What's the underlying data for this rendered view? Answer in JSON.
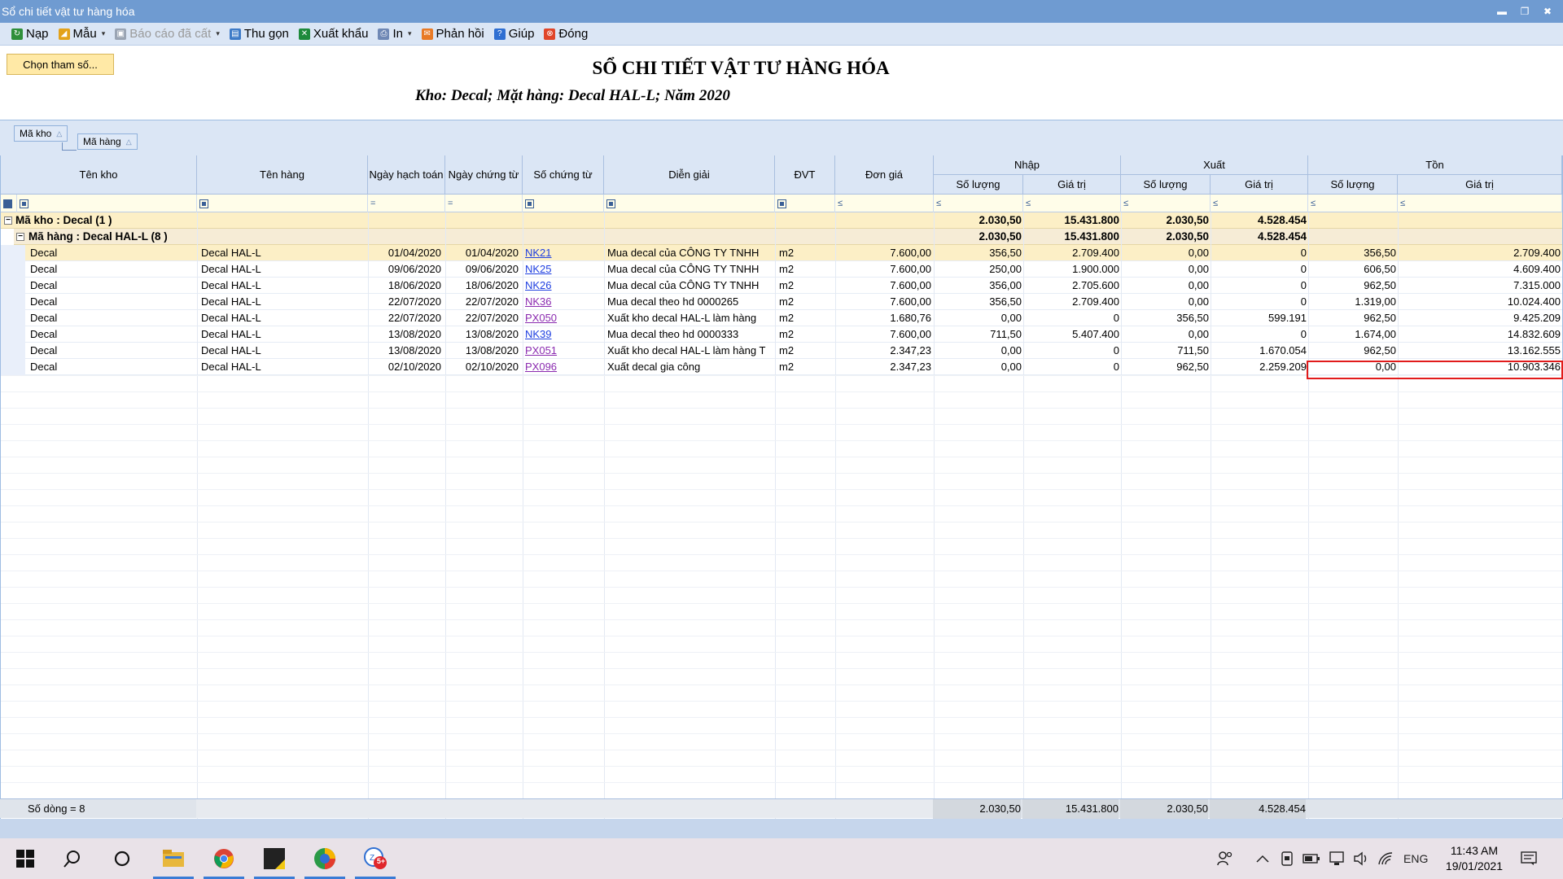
{
  "window": {
    "title": "Sổ chi tiết vật tư hàng hóa"
  },
  "toolbar": {
    "items": [
      {
        "label": "Nạp",
        "icon": "refresh-icon",
        "color": "#2f8f3a",
        "disabled": false,
        "dropdown": false
      },
      {
        "label": "Mẫu",
        "icon": "template-icon",
        "color": "#e3a21a",
        "disabled": false,
        "dropdown": true
      },
      {
        "label": "Báo cáo đã cất",
        "icon": "save-icon",
        "color": "#9aa4b3",
        "disabled": true,
        "dropdown": true
      },
      {
        "label": "Thu gọn",
        "icon": "collapse-icon",
        "color": "#3e7bc7",
        "disabled": false,
        "dropdown": false
      },
      {
        "label": "Xuất khẩu",
        "icon": "excel-icon",
        "color": "#1e8a3c",
        "disabled": false,
        "dropdown": false
      },
      {
        "label": "In",
        "icon": "printer-icon",
        "color": "#6f88b5",
        "disabled": false,
        "dropdown": true
      },
      {
        "label": "Phản hồi",
        "icon": "mail-icon",
        "color": "#e87a26",
        "disabled": false,
        "dropdown": false
      },
      {
        "label": "Giúp",
        "icon": "help-icon",
        "color": "#2f6fd2",
        "disabled": false,
        "dropdown": false
      },
      {
        "label": "Đóng",
        "icon": "close-icon",
        "color": "#e0462a",
        "disabled": false,
        "dropdown": false
      }
    ]
  },
  "params_button": "Chọn tham số...",
  "report": {
    "title": "SỔ CHI TIẾT VẬT TƯ HÀNG HÓA",
    "subtitle": "Kho: Decal; Mặt hàng: Decal HAL-L; Năm 2020"
  },
  "group_panel": {
    "chip1": "Mã kho",
    "chip2": "Mã hàng"
  },
  "columns": {
    "ten_kho": "Tên kho",
    "ten_hang": "Tên hàng",
    "ngay_hach_toan": "Ngày hạch toán",
    "ngay_chung_tu": "Ngày chứng từ",
    "so_chung_tu": "Số chứng từ",
    "dien_giai": "Diễn giải",
    "dvt": "ĐVT",
    "don_gia": "Đơn giá",
    "nhap": "Nhập",
    "xuat": "Xuất",
    "ton": "Tồn",
    "so_luong": "Số lượng",
    "gia_tri": "Giá trị"
  },
  "group1": {
    "label": "Mã kho : Decal (1 )",
    "nhap_sl": "2.030,50",
    "nhap_gt": "15.431.800",
    "xuat_sl": "2.030,50",
    "xuat_gt": "4.528.454"
  },
  "group2": {
    "label": "Mã hàng : Decal HAL-L (8 )",
    "nhap_sl": "2.030,50",
    "nhap_gt": "15.431.800",
    "xuat_sl": "2.030,50",
    "xuat_gt": "4.528.454"
  },
  "rows": [
    {
      "kho": "Decal",
      "hang": "Decal HAL-L",
      "nht": "01/04/2020",
      "nct": "01/04/2020",
      "sct": "NK21",
      "link": "blue",
      "dg": "Mua decal của CÔNG TY TNHH",
      "dvt": "m2",
      "gia": "7.600,00",
      "n_sl": "356,50",
      "n_gt": "2.709.400",
      "x_sl": "0,00",
      "x_gt": "0",
      "t_sl": "356,50",
      "t_gt": "2.709.400"
    },
    {
      "kho": "Decal",
      "hang": "Decal HAL-L",
      "nht": "09/06/2020",
      "nct": "09/06/2020",
      "sct": "NK25",
      "link": "blue",
      "dg": "Mua decal của CÔNG TY TNHH",
      "dvt": "m2",
      "gia": "7.600,00",
      "n_sl": "250,00",
      "n_gt": "1.900.000",
      "x_sl": "0,00",
      "x_gt": "0",
      "t_sl": "606,50",
      "t_gt": "4.609.400"
    },
    {
      "kho": "Decal",
      "hang": "Decal HAL-L",
      "nht": "18/06/2020",
      "nct": "18/06/2020",
      "sct": "NK26",
      "link": "blue",
      "dg": "Mua decal của CÔNG TY TNHH",
      "dvt": "m2",
      "gia": "7.600,00",
      "n_sl": "356,00",
      "n_gt": "2.705.600",
      "x_sl": "0,00",
      "x_gt": "0",
      "t_sl": "962,50",
      "t_gt": "7.315.000"
    },
    {
      "kho": "Decal",
      "hang": "Decal HAL-L",
      "nht": "22/07/2020",
      "nct": "22/07/2020",
      "sct": "NK36",
      "link": "purple",
      "dg": "Mua decal theo hd 0000265",
      "dvt": "m2",
      "gia": "7.600,00",
      "n_sl": "356,50",
      "n_gt": "2.709.400",
      "x_sl": "0,00",
      "x_gt": "0",
      "t_sl": "1.319,00",
      "t_gt": "10.024.400"
    },
    {
      "kho": "Decal",
      "hang": "Decal HAL-L",
      "nht": "22/07/2020",
      "nct": "22/07/2020",
      "sct": "PX050",
      "link": "purple",
      "dg": "Xuất kho decal HAL-L  làm hàng",
      "dvt": "m2",
      "gia": "1.680,76",
      "n_sl": "0,00",
      "n_gt": "0",
      "x_sl": "356,50",
      "x_gt": "599.191",
      "t_sl": "962,50",
      "t_gt": "9.425.209"
    },
    {
      "kho": "Decal",
      "hang": "Decal HAL-L",
      "nht": "13/08/2020",
      "nct": "13/08/2020",
      "sct": "NK39",
      "link": "blue",
      "dg": "Mua decal theo hd 0000333",
      "dvt": "m2",
      "gia": "7.600,00",
      "n_sl": "711,50",
      "n_gt": "5.407.400",
      "x_sl": "0,00",
      "x_gt": "0",
      "t_sl": "1.674,00",
      "t_gt": "14.832.609"
    },
    {
      "kho": "Decal",
      "hang": "Decal HAL-L",
      "nht": "13/08/2020",
      "nct": "13/08/2020",
      "sct": "PX051",
      "link": "purple",
      "dg": "Xuất kho decal HAL-L làm hàng T",
      "dvt": "m2",
      "gia": "2.347,23",
      "n_sl": "0,00",
      "n_gt": "0",
      "x_sl": "711,50",
      "x_gt": "1.670.054",
      "t_sl": "962,50",
      "t_gt": "13.162.555"
    },
    {
      "kho": "Decal",
      "hang": "Decal HAL-L",
      "nht": "02/10/2020",
      "nct": "02/10/2020",
      "sct": "PX096",
      "link": "purple",
      "dg": "Xuất decal gia công",
      "dvt": "m2",
      "gia": "2.347,23",
      "n_sl": "0,00",
      "n_gt": "0",
      "x_sl": "962,50",
      "x_gt": "2.259.209",
      "t_sl": "0,00",
      "t_gt": "10.903.346"
    }
  ],
  "footer": {
    "count": "Số dòng = 8",
    "nhap_sl": "2.030,50",
    "nhap_gt": "15.431.800",
    "xuat_sl": "2.030,50",
    "xuat_gt": "4.528.454"
  },
  "taskbar": {
    "language": "ENG",
    "time": "11:43 AM",
    "date": "19/01/2021",
    "zalo_badge": "5+"
  },
  "colors": {
    "titlebar": "#6f9bd1",
    "toolbar": "#dbe6f5",
    "selected_row": "#fcefc6",
    "highlight": "#e11b1b"
  }
}
